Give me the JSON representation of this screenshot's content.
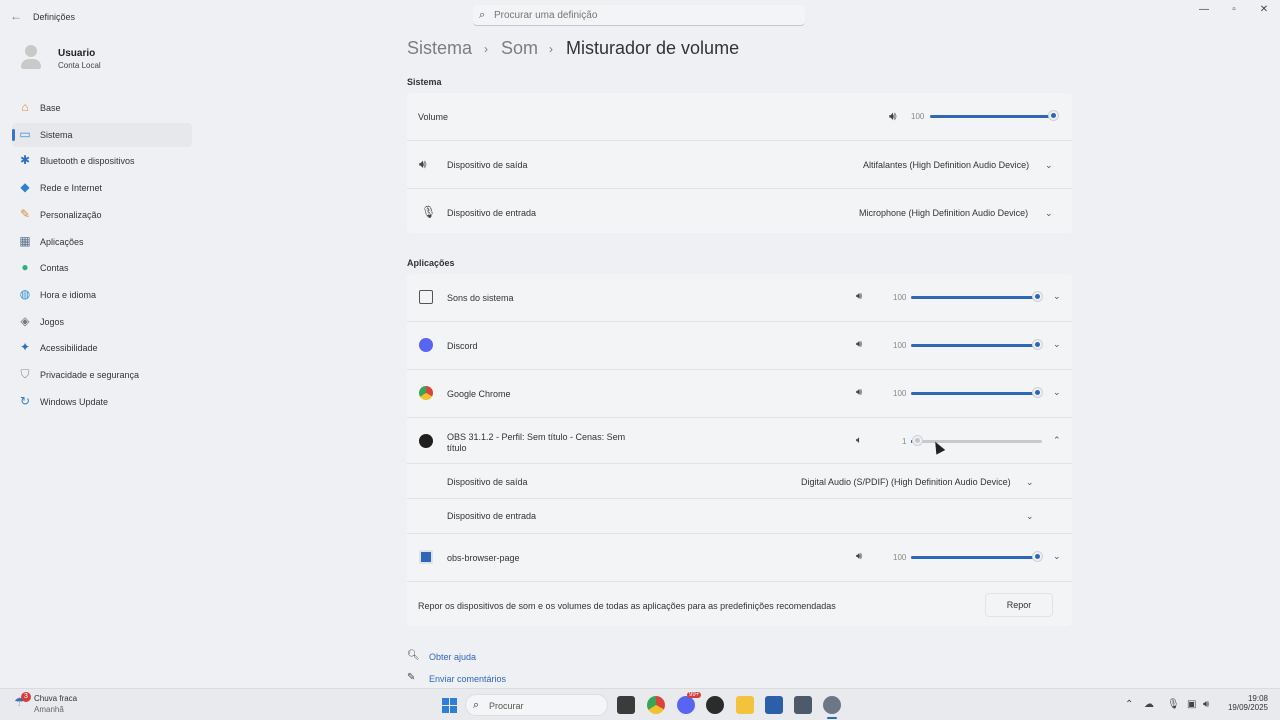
{
  "window": {
    "title": "Definições",
    "search_placeholder": "Procurar uma definição"
  },
  "user": {
    "name": "Usuario",
    "account": "Conta Local"
  },
  "sidebar": {
    "items": [
      {
        "label": "Base",
        "icon": "home-icon",
        "color": "#e3893a"
      },
      {
        "label": "Sistema",
        "icon": "system-icon",
        "color": "#3a8fd8"
      },
      {
        "label": "Bluetooth e dispositivos",
        "icon": "bluetooth-icon",
        "color": "#2d6fc5"
      },
      {
        "label": "Rede e Internet",
        "icon": "wifi-icon",
        "color": "#2f7fd0"
      },
      {
        "label": "Personalização",
        "icon": "brush-icon",
        "color": "#d68a3a"
      },
      {
        "label": "Aplicações",
        "icon": "apps-icon",
        "color": "#5c6f8c"
      },
      {
        "label": "Contas",
        "icon": "person-icon",
        "color": "#2fb07a"
      },
      {
        "label": "Hora e idioma",
        "icon": "globe-clock-icon",
        "color": "#2f8fd0"
      },
      {
        "label": "Jogos",
        "icon": "gamepad-icon",
        "color": "#777777"
      },
      {
        "label": "Acessibilidade",
        "icon": "accessibility-icon",
        "color": "#2b6fc0"
      },
      {
        "label": "Privacidade e segurança",
        "icon": "shield-icon",
        "color": "#8a8f96"
      },
      {
        "label": "Windows Update",
        "icon": "update-icon",
        "color": "#2f7fd0"
      }
    ]
  },
  "breadcrumb": {
    "level1": "Sistema",
    "level2": "Som",
    "current": "Misturador de volume"
  },
  "system_section": {
    "heading": "Sistema",
    "volume_label": "Volume",
    "volume_value": "100",
    "volume_level": 100,
    "output_label": "Dispositivo de saída",
    "output_value": "Altifalantes (High Definition Audio Device)",
    "input_label": "Dispositivo de entrada",
    "input_value": "Microphone (High Definition Audio Device)"
  },
  "apps_section": {
    "heading": "Aplicações",
    "apps": [
      {
        "name": "Sons do sistema",
        "value": "100",
        "level": 100,
        "icon": "speaker-device-icon",
        "expanded": false
      },
      {
        "name": "Discord",
        "value": "100",
        "level": 100,
        "icon": "discord-icon",
        "expanded": false
      },
      {
        "name": "Google Chrome",
        "value": "100",
        "level": 100,
        "icon": "chrome-icon",
        "expanded": false
      },
      {
        "name": "OBS 31.1.2 - Perfil: Sem título - Cenas: Sem título",
        "value": "1",
        "level": 1,
        "icon": "obs-icon",
        "expanded": true
      },
      {
        "name": "obs-browser-page",
        "value": "100",
        "level": 100,
        "icon": "window-icon",
        "expanded": false
      }
    ],
    "obs_output_label": "Dispositivo de saída",
    "obs_output_value": "Digital Audio (S/PDIF) (High Definition Audio Device)",
    "obs_input_label": "Dispositivo de entrada",
    "obs_input_value": ""
  },
  "reset": {
    "text": "Repor os dispositivos de som e os volumes de todas as aplicações para as predefinições recomendadas",
    "button": "Repor"
  },
  "links": {
    "help": "Obter ajuda",
    "feedback": "Enviar comentários"
  },
  "taskbar": {
    "weather_title": "Chuva fraca",
    "weather_sub": "Amanhã",
    "weather_badge": "3",
    "search_label": "Procurar",
    "discord_badge": "99+",
    "time": "19:08",
    "date": "19/09/2025"
  },
  "colors": {
    "accent": "#2f67b8",
    "background": "#eef0f3",
    "card": "#f3f4f6"
  }
}
